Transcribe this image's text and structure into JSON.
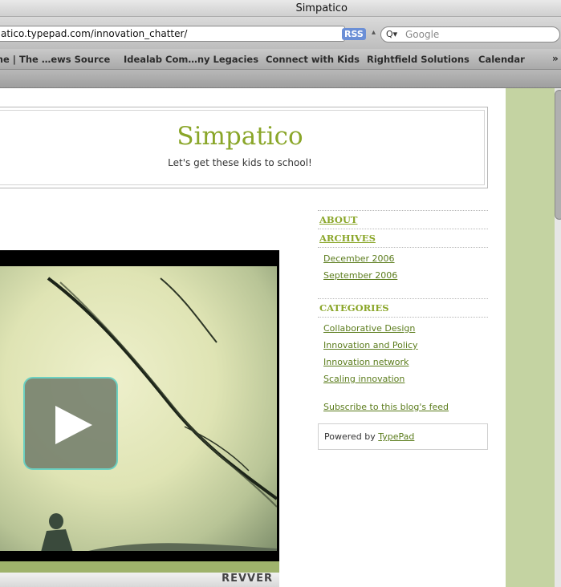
{
  "browser": {
    "window_title": "Simpatico",
    "url": "atico.typepad.com/innovation_chatter/",
    "rss_label": "RSS",
    "search_placeholder": "Google",
    "search_icon": "magnifier-icon",
    "bookmarks": [
      "me | The …ews Source",
      "Idealab Com…ny Legacies",
      "Connect with Kids",
      "Rightfield Solutions",
      "Calendar"
    ],
    "bookmarks_overflow": "»"
  },
  "site": {
    "title": "Simpatico",
    "tagline": "Let's get these kids to school!"
  },
  "video": {
    "logo_text": "REVVER",
    "play_icon": "play-icon"
  },
  "sidebar": {
    "about": "ABOUT",
    "archives": "ARCHIVES",
    "archive_links": [
      "December 2006",
      "September 2006"
    ],
    "categories": "CATEGORIES",
    "category_links": [
      "Collaborative Design",
      "Innovation and Policy",
      "Innovation network",
      "Scaling innovation"
    ],
    "subscribe": "Subscribe to this blog's feed",
    "powered_prefix": "Powered by",
    "powered_link": "TypePad"
  },
  "colors": {
    "accent_green": "#8aa629",
    "link_green": "#5b7c1c",
    "page_side_green": "#c4d3a2"
  }
}
